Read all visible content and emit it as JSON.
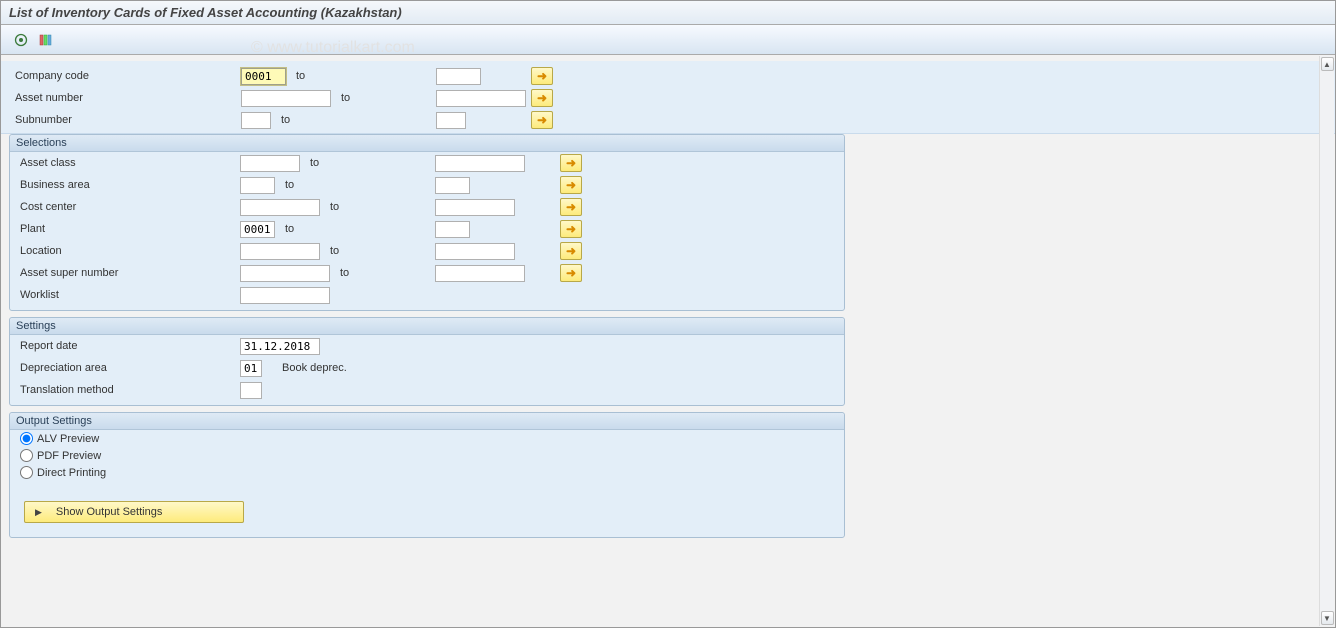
{
  "title": "List of Inventory Cards of Fixed Asset Accounting (Kazakhstan)",
  "watermark": "© www.tutorialkart.com",
  "top": {
    "company_code_label": "Company code",
    "company_code_value": "0001",
    "asset_number_label": "Asset number",
    "subnumber_label": "Subnumber",
    "to": "to"
  },
  "selections": {
    "title": "Selections",
    "asset_class": "Asset class",
    "business_area": "Business area",
    "cost_center": "Cost center",
    "plant": "Plant",
    "plant_value": "0001",
    "location": "Location",
    "asset_super_number": "Asset super number",
    "worklist": "Worklist",
    "to": "to"
  },
  "settings": {
    "title": "Settings",
    "report_date": "Report date",
    "report_date_value": "31.12.2018",
    "depreciation_area": "Depreciation area",
    "depreciation_area_value": "01",
    "depreciation_area_text": "Book deprec.",
    "translation_method": "Translation method"
  },
  "output": {
    "title": "Output Settings",
    "alv": "ALV Preview",
    "pdf": "PDF Preview",
    "direct": "Direct Printing",
    "show_btn": "Show Output Settings"
  }
}
